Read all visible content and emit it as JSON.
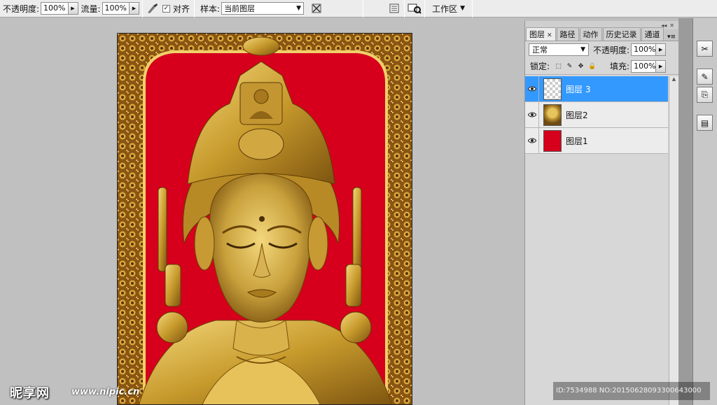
{
  "options_bar": {
    "opacity_label": "不透明度:",
    "opacity_value": "100%",
    "flow_label": "流量:",
    "flow_value": "100%",
    "align_label": "对齐",
    "sample_label": "样本:",
    "sample_value": "当前图层",
    "workspace_label": "工作区"
  },
  "layers_panel": {
    "tabs": [
      {
        "label": "图层",
        "active": true
      },
      {
        "label": "路径"
      },
      {
        "label": "动作"
      },
      {
        "label": "历史记录"
      },
      {
        "label": "通道"
      }
    ],
    "blend_mode": "正常",
    "opacity_label": "不透明度:",
    "opacity_value": "100%",
    "lock_label": "锁定:",
    "fill_label": "填充:",
    "fill_value": "100%",
    "layers": [
      {
        "name": "图层 3",
        "selected": true
      },
      {
        "name": "图层2"
      },
      {
        "name": "图层1"
      }
    ]
  },
  "watermark": {
    "logo": "昵享网",
    "url": "www.nipic.cn",
    "id_text": "ID:7534988 NO:20150628093300643000"
  },
  "colors": {
    "selection": "#3399ff",
    "background_red": "#d6001c",
    "gold": "#c9a23a"
  }
}
